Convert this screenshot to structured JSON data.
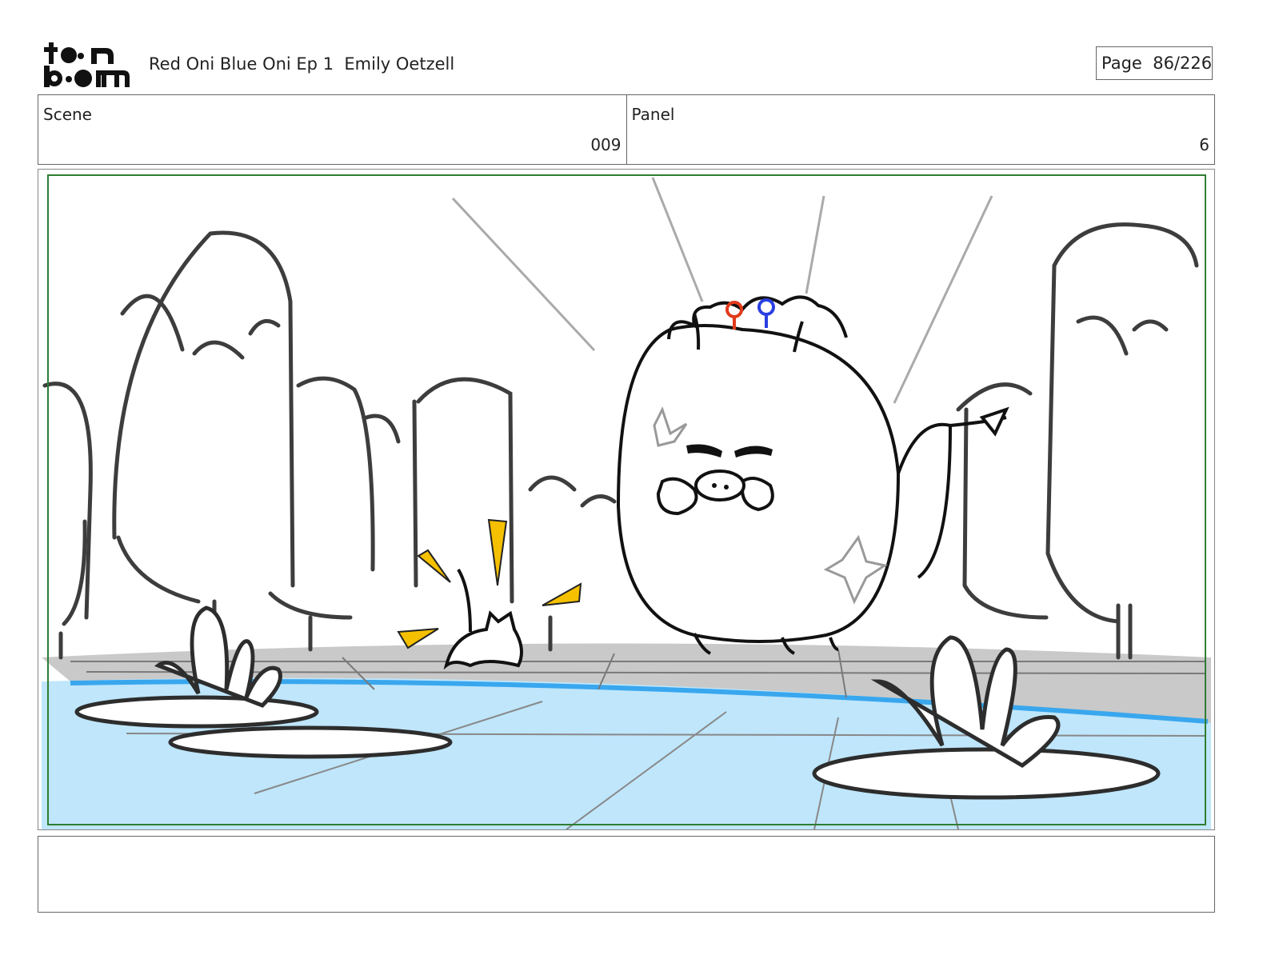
{
  "header": {
    "logo_text": "toonboom",
    "title": "Red Oni Blue Oni Ep 1  Emily Oetzell",
    "page_label": "Page",
    "page_value": "86/226"
  },
  "info": {
    "scene_label": "Scene",
    "scene_value": "009",
    "panel_label": "Panel",
    "panel_value": "6"
  },
  "panel": {
    "safe_frame_color": "#2f7d32",
    "water_color": "#bfe6fb",
    "water_edge_color": "#39a7ee",
    "ground_color": "#c9c9c9",
    "accent_colors": {
      "impact": "#f5c000",
      "red_antenna": "#e03a1a",
      "blue_antenna": "#2a3fe0"
    }
  },
  "notes": {
    "text": ""
  }
}
